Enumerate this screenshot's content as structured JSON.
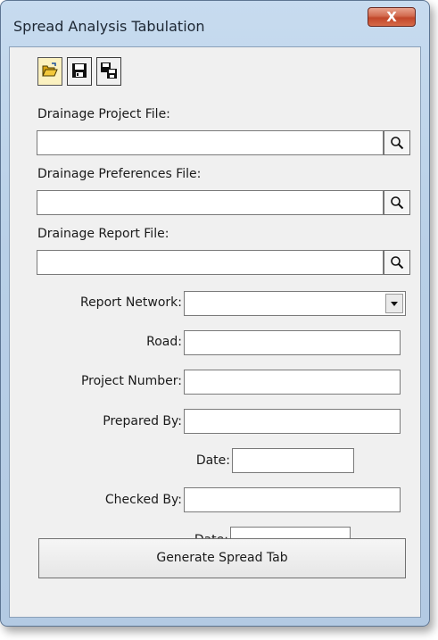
{
  "window": {
    "title": "Spread Analysis Tabulation",
    "close_label": "X"
  },
  "toolbar": {
    "buttons": [
      {
        "name": "open-folder-icon"
      },
      {
        "name": "save-icon"
      },
      {
        "name": "save-as-icon"
      }
    ]
  },
  "files": {
    "project_label": "Drainage Project File:",
    "project_value": "",
    "preferences_label": "Drainage Preferences File:",
    "preferences_value": "",
    "report_label": "Drainage Report File:",
    "report_value": ""
  },
  "form": {
    "report_network_label": "Report Network:",
    "report_network_value": "",
    "road_label": "Road:",
    "road_value": "",
    "project_number_label": "Project Number:",
    "project_number_value": "",
    "prepared_by_label": "Prepared By:",
    "prepared_by_value": "",
    "prepared_date_label": "Date:",
    "prepared_date_value": "",
    "checked_by_label": "Checked By:",
    "checked_by_value": "",
    "checked_date_label": "Date:",
    "checked_date_value": ""
  },
  "actions": {
    "generate_label": "Generate Spread Tab"
  }
}
